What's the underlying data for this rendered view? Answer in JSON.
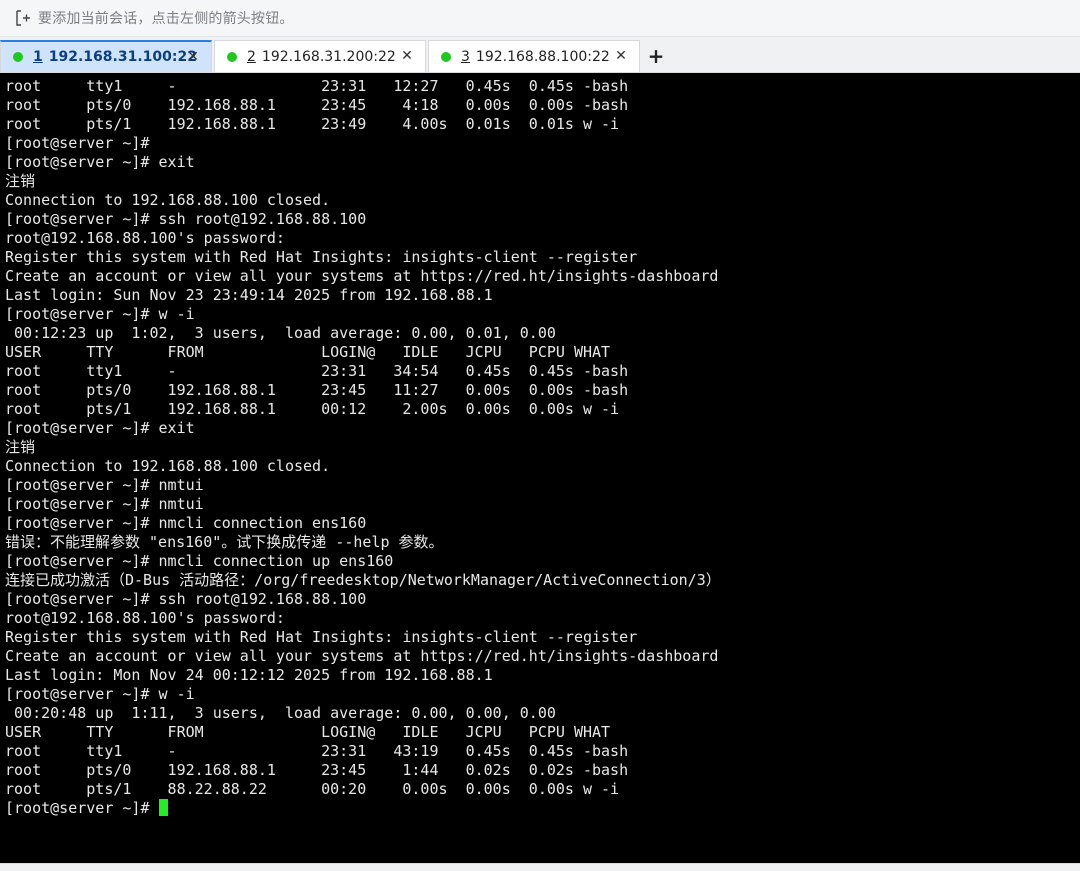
{
  "hint_bar": {
    "icon": "add-session-icon",
    "text": "要添加当前会话，点击左侧的箭头按钮。"
  },
  "tabs": [
    {
      "number": "1",
      "title": "192.168.31.100:22",
      "active": true,
      "status_color": "#1ec81e"
    },
    {
      "number": "2",
      "title": "192.168.31.200:22",
      "active": false,
      "status_color": "#1ec81e"
    },
    {
      "number": "3",
      "title": "192.168.88.100:22",
      "active": false,
      "status_color": "#1ec81e"
    }
  ],
  "tab_close_glyph": "✕",
  "tab_add_glyph": "+",
  "terminal": {
    "background": "#000000",
    "foreground": "#e8e8e8",
    "cursor_color": "#22ee22",
    "lines": [
      "root     tty1     -                23:31   12:27   0.45s  0.45s -bash",
      "root     pts/0    192.168.88.1     23:45    4:18   0.00s  0.00s -bash",
      "root     pts/1    192.168.88.1     23:49    4.00s  0.01s  0.01s w -i",
      "[root@server ~]#",
      "[root@server ~]# exit",
      "注销",
      "Connection to 192.168.88.100 closed.",
      "[root@server ~]# ssh root@192.168.88.100",
      "root@192.168.88.100's password:",
      "Register this system with Red Hat Insights: insights-client --register",
      "Create an account or view all your systems at https://red.ht/insights-dashboard",
      "Last login: Sun Nov 23 23:49:14 2025 from 192.168.88.1",
      "[root@server ~]# w -i",
      " 00:12:23 up  1:02,  3 users,  load average: 0.00, 0.01, 0.00",
      "USER     TTY      FROM             LOGIN@   IDLE   JCPU   PCPU WHAT",
      "root     tty1     -                23:31   34:54   0.45s  0.45s -bash",
      "root     pts/0    192.168.88.1     23:45   11:27   0.00s  0.00s -bash",
      "root     pts/1    192.168.88.1     00:12    2.00s  0.00s  0.00s w -i",
      "[root@server ~]# exit",
      "注销",
      "Connection to 192.168.88.100 closed.",
      "[root@server ~]# nmtui",
      "[root@server ~]# nmtui",
      "[root@server ~]# nmcli connection ens160",
      "错误：不能理解参数 \"ens160\"。试下换成传递 --help 参数。",
      "[root@server ~]# nmcli connection up ens160",
      "连接已成功激活（D-Bus 活动路径：/org/freedesktop/NetworkManager/ActiveConnection/3）",
      "[root@server ~]# ssh root@192.168.88.100",
      "root@192.168.88.100's password:",
      "Register this system with Red Hat Insights: insights-client --register",
      "Create an account or view all your systems at https://red.ht/insights-dashboard",
      "Last login: Mon Nov 24 00:12:12 2025 from 192.168.88.1",
      "[root@server ~]# w -i",
      " 00:20:48 up  1:11,  3 users,  load average: 0.00, 0.00, 0.00",
      "USER     TTY      FROM             LOGIN@   IDLE   JCPU   PCPU WHAT",
      "root     tty1     -                23:31   43:19   0.45s  0.45s -bash",
      "root     pts/0    192.168.88.1     23:45    1:44   0.02s  0.02s -bash",
      "root     pts/1    88.22.88.22      00:20    0.00s  0.00s  0.00s w -i"
    ],
    "prompt": "[root@server ~]# "
  }
}
